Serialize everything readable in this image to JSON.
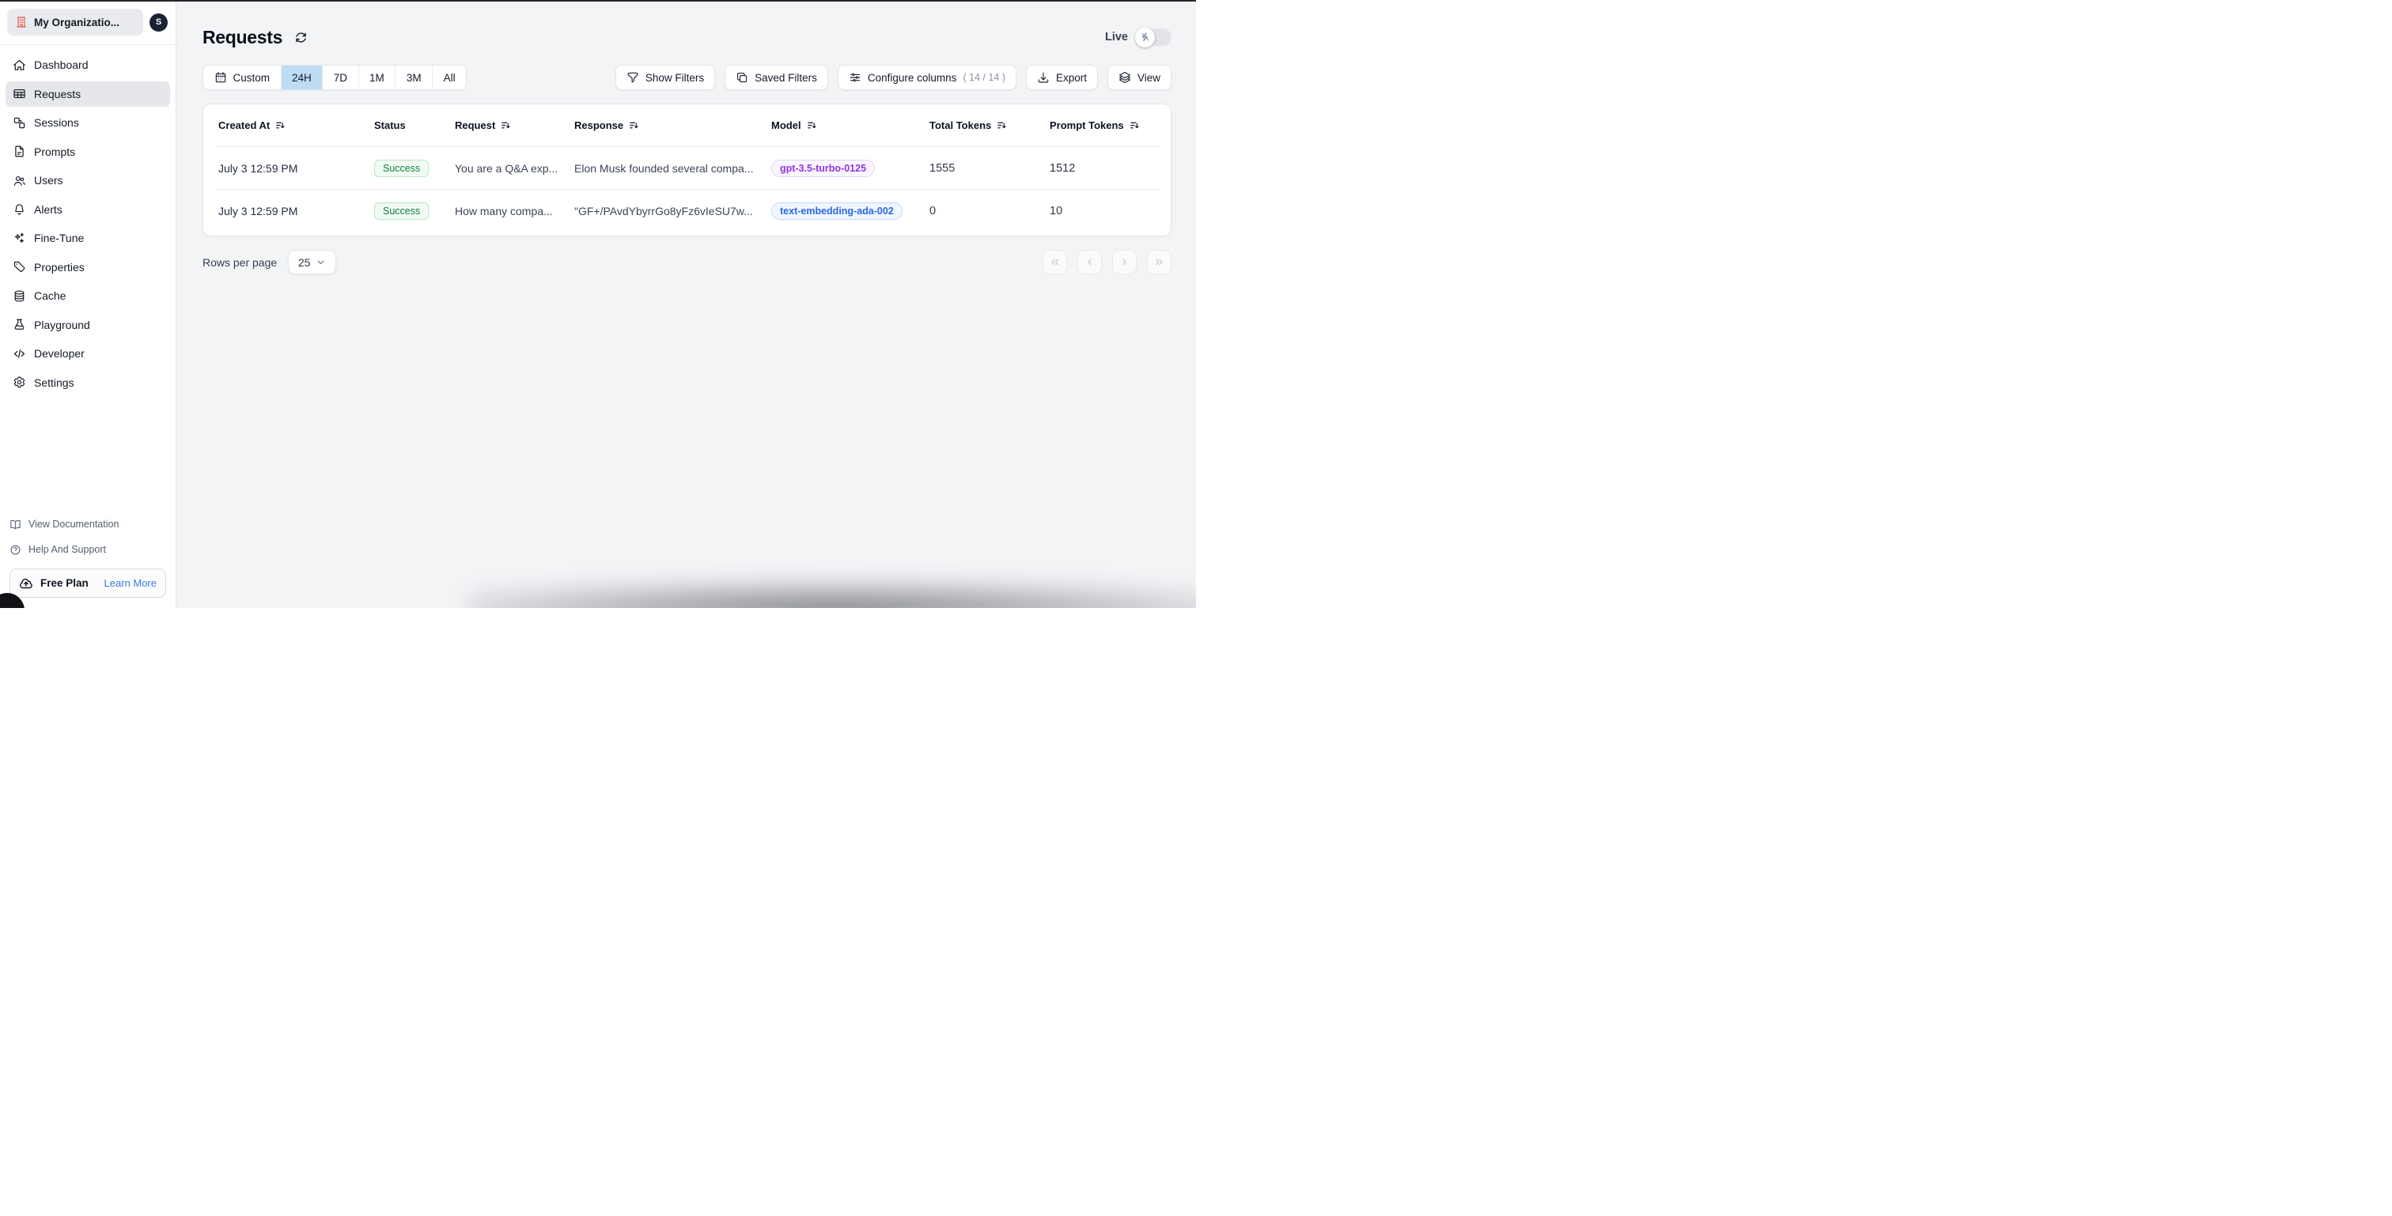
{
  "org": {
    "name": "My Organizatio...",
    "avatar_initial": "S",
    "icon": "building-icon"
  },
  "sidebar": {
    "items": [
      {
        "label": "Dashboard",
        "icon": "home-icon",
        "active": false
      },
      {
        "label": "Requests",
        "icon": "table-icon",
        "active": true
      },
      {
        "label": "Sessions",
        "icon": "sessions-icon",
        "active": false
      },
      {
        "label": "Prompts",
        "icon": "document-icon",
        "active": false
      },
      {
        "label": "Users",
        "icon": "users-icon",
        "active": false
      },
      {
        "label": "Alerts",
        "icon": "bell-icon",
        "active": false
      },
      {
        "label": "Fine-Tune",
        "icon": "sparkles-icon",
        "active": false
      },
      {
        "label": "Properties",
        "icon": "tag-icon",
        "active": false
      },
      {
        "label": "Cache",
        "icon": "database-icon",
        "active": false
      },
      {
        "label": "Playground",
        "icon": "beaker-icon",
        "active": false
      },
      {
        "label": "Developer",
        "icon": "code-icon",
        "active": false
      },
      {
        "label": "Settings",
        "icon": "gear-icon",
        "active": false
      }
    ],
    "footer_links": [
      {
        "label": "View Documentation",
        "icon": "book-open-icon"
      },
      {
        "label": "Help And Support",
        "icon": "question-circle-icon"
      }
    ],
    "plan": {
      "label": "Free Plan",
      "cta": "Learn More",
      "icon": "cloud-arrow-up-icon"
    }
  },
  "header": {
    "title": "Requests",
    "live_label": "Live",
    "live_on": false
  },
  "toolbar": {
    "time_ranges": [
      {
        "label": "Custom",
        "icon": "calendar-icon",
        "selected": false
      },
      {
        "label": "24H",
        "selected": true
      },
      {
        "label": "7D",
        "selected": false
      },
      {
        "label": "1M",
        "selected": false
      },
      {
        "label": "3M",
        "selected": false
      },
      {
        "label": "All",
        "selected": false
      }
    ],
    "actions": [
      {
        "label": "Show Filters",
        "icon": "funnel-icon"
      },
      {
        "label": "Saved Filters",
        "icon": "copy-icon"
      },
      {
        "label": "Configure columns",
        "suffix": "( 14 / 14 )",
        "icon": "sliders-icon"
      },
      {
        "label": "Export",
        "icon": "download-icon"
      },
      {
        "label": "View",
        "icon": "layers-icon"
      }
    ]
  },
  "table": {
    "columns": [
      {
        "label": "Created At",
        "sortable": true
      },
      {
        "label": "Status",
        "sortable": false
      },
      {
        "label": "Request",
        "sortable": true
      },
      {
        "label": "Response",
        "sortable": true
      },
      {
        "label": "Model",
        "sortable": true
      },
      {
        "label": "Total Tokens",
        "sortable": true
      },
      {
        "label": "Prompt Tokens",
        "sortable": true
      }
    ],
    "rows": [
      {
        "created_at": "July 3 12:59 PM",
        "status": "Success",
        "request": "You are a Q&A exp...",
        "response": "Elon Musk founded several compa...",
        "model": "gpt-3.5-turbo-0125",
        "model_color": "purple",
        "total_tokens": "1555",
        "prompt_tokens": "1512"
      },
      {
        "created_at": "July 3 12:59 PM",
        "status": "Success",
        "request": "How many compa...",
        "response": "\"GF+/PAvdYbyrrGo8yFz6vIeSU7w...",
        "model": "text-embedding-ada-002",
        "model_color": "blue",
        "total_tokens": "0",
        "prompt_tokens": "10"
      }
    ]
  },
  "pagination": {
    "rows_per_page_label": "Rows per page",
    "rows_per_page_value": "25"
  },
  "colors": {
    "selected_range_bg": "#bedcf4",
    "success_text": "#17813e",
    "success_bg": "#f0faf3",
    "model_purple": "#8f34e4",
    "model_blue": "#2e66e5",
    "org_icon_red": "#e8564f",
    "link_blue": "#3779e3",
    "main_bg": "#f3f4f6"
  }
}
